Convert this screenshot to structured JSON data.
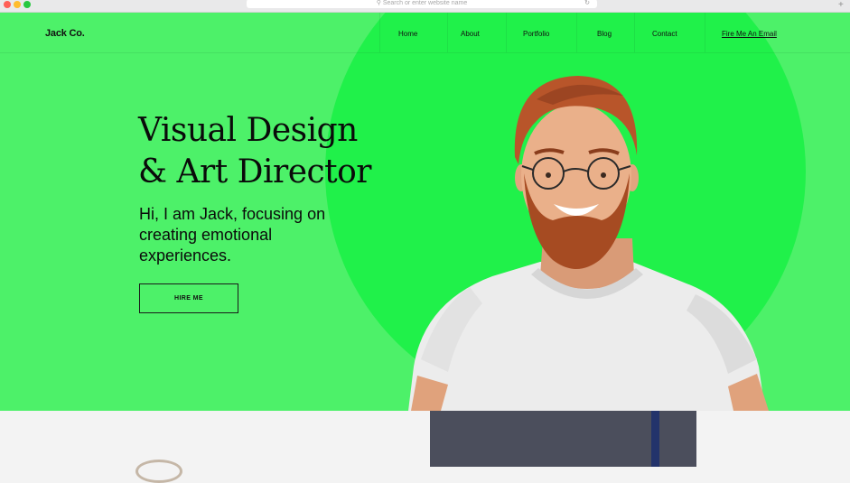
{
  "browser": {
    "address_placeholder": "Search or enter website name",
    "reload_icon": "reload-icon",
    "newtab_icon": "plus-icon"
  },
  "site": {
    "logo": "Jack Co.",
    "nav": {
      "home": "Home",
      "about": "About",
      "portfolio": "Portfolio",
      "blog": "Blog",
      "contact": "Contact",
      "email_cta": "Fire Me An Email"
    }
  },
  "hero": {
    "headline_line1": "Visual Design",
    "headline_line2": "& Art Director",
    "subtitle_line1": "Hi, I am Jack, focusing on",
    "subtitle_line2": "creating emotional",
    "subtitle_line3": "experiences.",
    "cta_label": "HIRE ME"
  },
  "colors": {
    "hero_background": "#4df169",
    "hero_circle": "#20f14a",
    "text": "#0a0a0a"
  }
}
